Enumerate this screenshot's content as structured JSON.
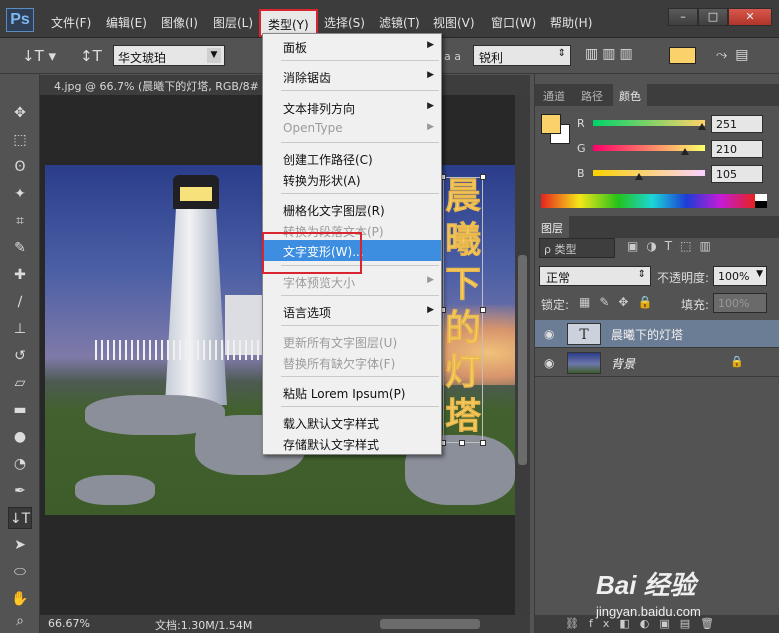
{
  "menubar": {
    "logo": "Ps",
    "items": [
      "文件(F)",
      "编辑(E)",
      "图像(I)",
      "图层(L)",
      "类型(Y)",
      "选择(S)",
      "滤镜(T)",
      "视图(V)",
      "窗口(W)",
      "帮助(H)"
    ],
    "active_index": 4
  },
  "optbar": {
    "font_family": "华文琥珀",
    "aa_label": "a a",
    "aa_value": "锐利",
    "color": "#fbd269"
  },
  "document": {
    "tab_title": "4.jpg @ 66.7% (晨曦下的灯塔, RGB/8#",
    "vertical_text": [
      "晨",
      "曦",
      "下",
      "的",
      "灯",
      "塔"
    ]
  },
  "statusbar": {
    "zoom": "66.67%",
    "doc_info": "文档:1.30M/1.54M"
  },
  "dropdown": {
    "items": [
      {
        "label": "面板",
        "disabled": false,
        "submenu": true
      },
      {
        "label": "消除锯齿",
        "disabled": false,
        "submenu": true
      },
      {
        "label": "文本排列方向",
        "disabled": false,
        "submenu": true
      },
      {
        "label": "OpenType",
        "disabled": true,
        "submenu": true
      },
      {
        "label": "创建工作路径(C)",
        "disabled": false,
        "submenu": false
      },
      {
        "label": "转换为形状(A)",
        "disabled": false,
        "submenu": false
      },
      {
        "label": "栅格化文字图层(R)",
        "disabled": false,
        "submenu": false
      },
      {
        "label": "转换为段落文本(P)",
        "disabled": true,
        "submenu": false
      },
      {
        "label": "文字变形(W)...",
        "disabled": false,
        "submenu": false,
        "highlighted": true
      },
      {
        "label": "字体预览大小",
        "disabled": true,
        "submenu": true
      },
      {
        "label": "语言选项",
        "disabled": false,
        "submenu": true
      },
      {
        "label": "更新所有文字图层(U)",
        "disabled": true,
        "submenu": false
      },
      {
        "label": "替换所有缺欠字体(F)",
        "disabled": true,
        "submenu": false
      },
      {
        "label": "粘贴 Lorem Ipsum(P)",
        "disabled": false,
        "submenu": false
      },
      {
        "label": "载入默认文字样式",
        "disabled": false,
        "submenu": false
      },
      {
        "label": "存储默认文字样式",
        "disabled": false,
        "submenu": false
      }
    ]
  },
  "color_panel": {
    "tabs": [
      "通道",
      "路径",
      "颜色"
    ],
    "active_tab": 2,
    "foreground": "#fbd269",
    "background": "#ffffff",
    "r_label": "R",
    "r_value": "251",
    "g_label": "G",
    "g_value": "210",
    "b_label": "B",
    "b_value": "105"
  },
  "layers_panel": {
    "tab": "图层",
    "search_placeholder": "ρ 类型",
    "blend_mode": "正常",
    "opacity_label": "不透明度:",
    "opacity_value": "100%",
    "lock_label": "锁定:",
    "fill_label": "填充:",
    "fill_value": "100%",
    "layers": [
      {
        "name": "晨曦下的灯塔",
        "type": "text",
        "selected": true
      },
      {
        "name": "背景",
        "type": "image",
        "selected": false,
        "locked": true
      }
    ]
  },
  "watermark": {
    "main": "Bai 经验",
    "sub": "jingyan.baidu.com"
  }
}
